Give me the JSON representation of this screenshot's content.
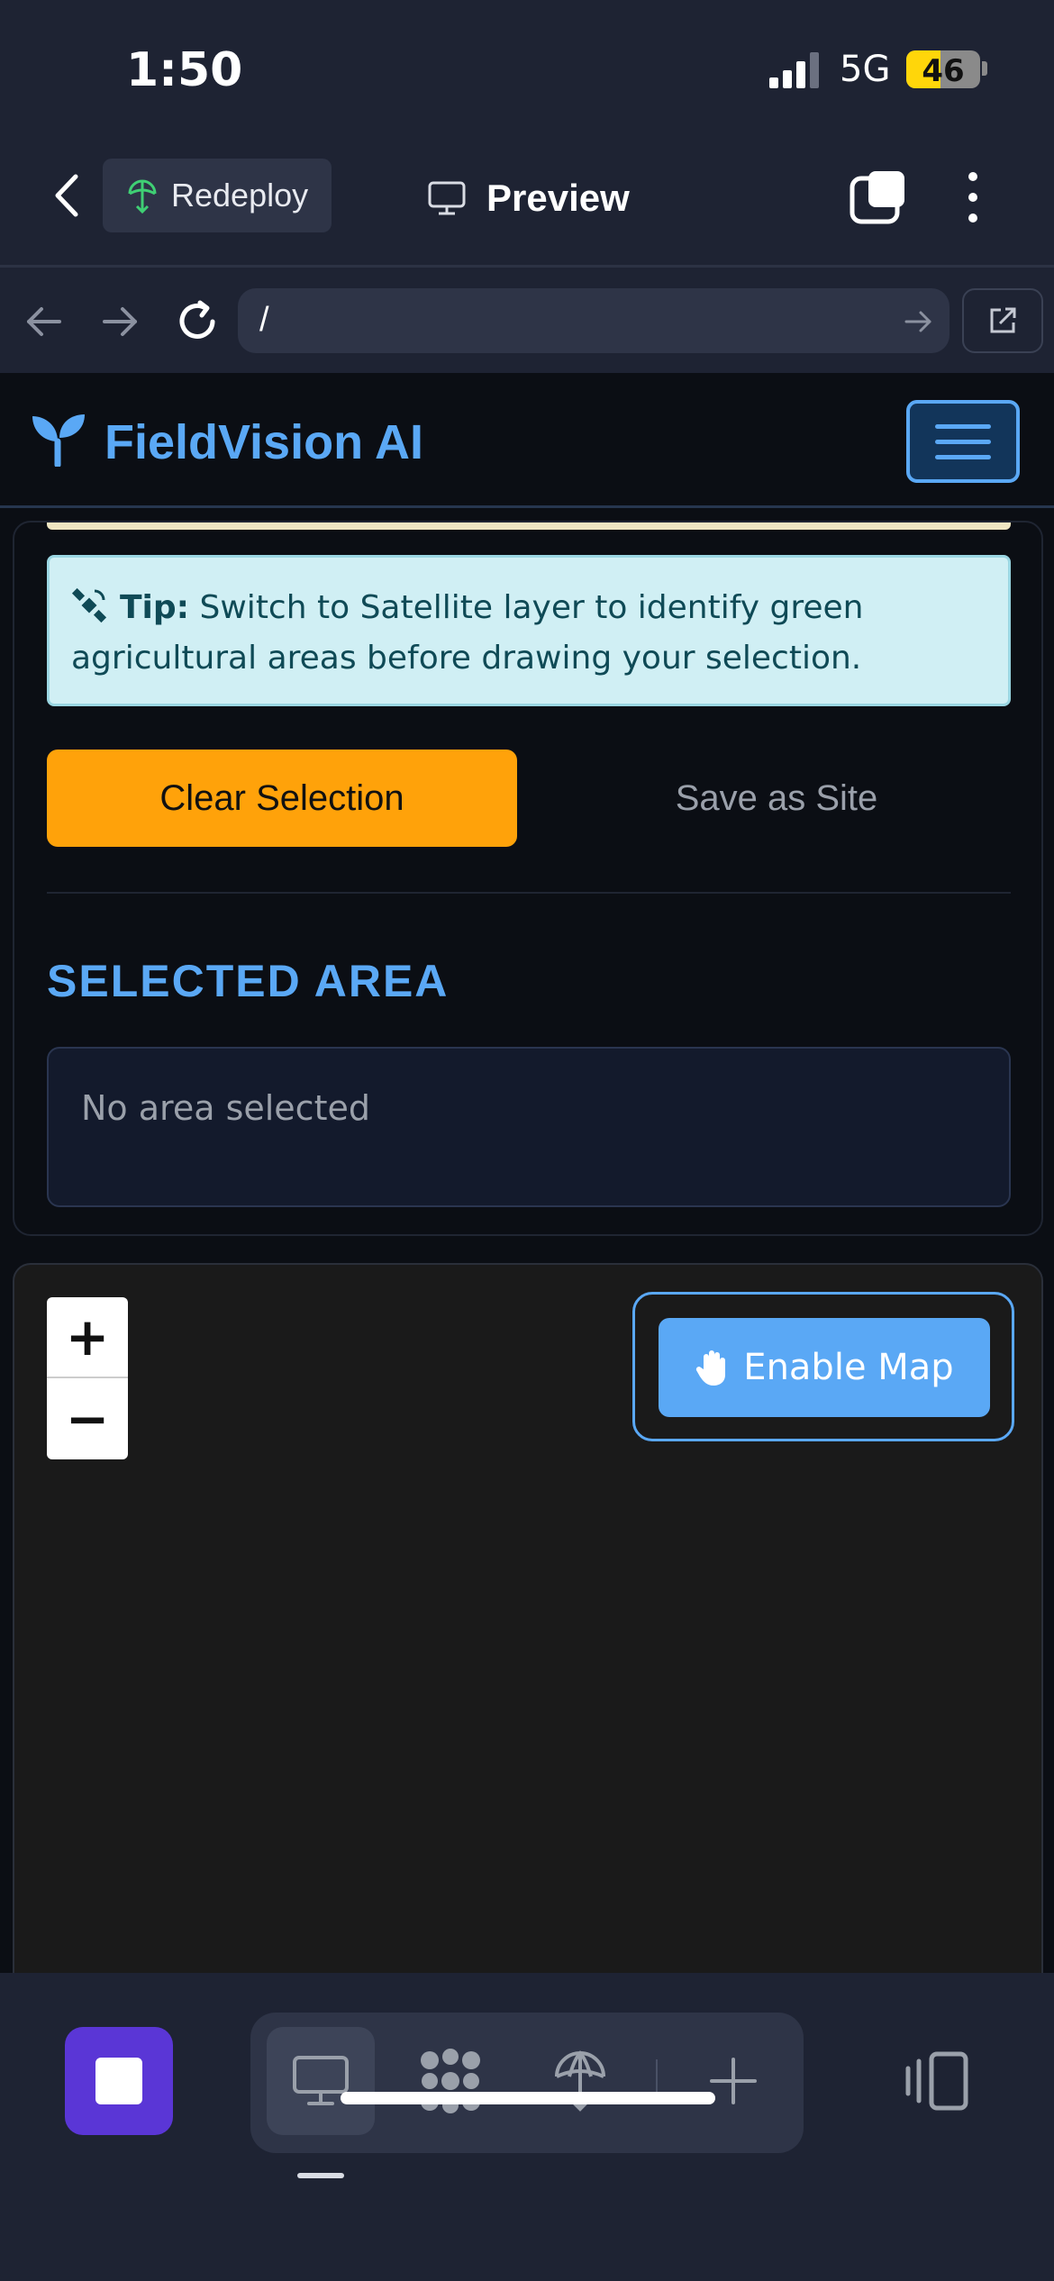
{
  "status_bar": {
    "time": "1:50",
    "network": "5G",
    "battery_level": "46",
    "battery_fraction": 0.46
  },
  "app_bar": {
    "redeploy_label": "Redeploy",
    "preview_label": "Preview"
  },
  "browser": {
    "url": "/"
  },
  "site": {
    "brand_name": "FieldVision AI",
    "accent_color": "#5aa8f5",
    "tip": {
      "label": "Tip:",
      "text": "Switch to Satellite layer to identify green agricultural areas before drawing your selection."
    },
    "buttons": {
      "clear_selection": "Clear Selection",
      "save_as_site": "Save as Site"
    },
    "selected_area": {
      "heading": "SELECTED AREA",
      "empty_text": "No area selected"
    },
    "map": {
      "zoom_in": "+",
      "zoom_out": "−",
      "enable_label": "Enable Map"
    }
  },
  "toolbar": {
    "items": [
      "stop-icon",
      "desktop-icon",
      "apps-icon",
      "deploy-icon",
      "plus-icon",
      "panel-icon"
    ]
  }
}
